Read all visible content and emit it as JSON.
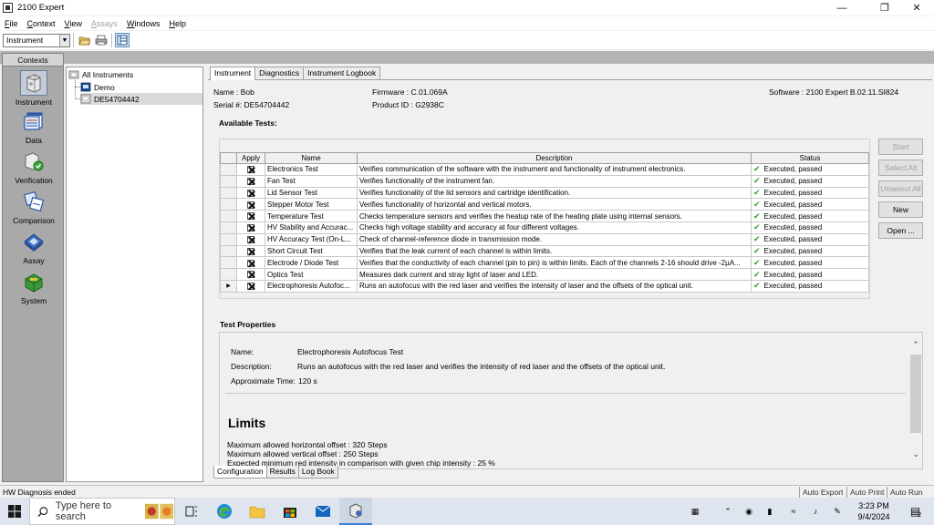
{
  "window": {
    "title": "2100 Expert"
  },
  "menu": [
    {
      "label": "File",
      "u": "F",
      "rest": "ile",
      "disabled": false
    },
    {
      "label": "Context",
      "u": "C",
      "rest": "ontext",
      "disabled": false
    },
    {
      "label": "View",
      "u": "V",
      "rest": "iew",
      "disabled": false
    },
    {
      "label": "Assays",
      "u": "A",
      "rest": "ssays",
      "disabled": true
    },
    {
      "label": "Windows",
      "u": "W",
      "rest": "indows",
      "disabled": false
    },
    {
      "label": "Help",
      "u": "H",
      "rest": "elp",
      "disabled": false
    }
  ],
  "toolbar": {
    "context_value": "Instrument"
  },
  "contexts": {
    "header": "Contexts",
    "items": [
      {
        "label": "Instrument",
        "icon": "instrument-icon"
      },
      {
        "label": "Data",
        "icon": "data-icon"
      },
      {
        "label": "Verification",
        "icon": "verification-icon"
      },
      {
        "label": "Comparison",
        "icon": "comparison-icon"
      },
      {
        "label": "Assay",
        "icon": "assay-icon"
      },
      {
        "label": "System",
        "icon": "system-icon"
      }
    ]
  },
  "tree": {
    "root": "All Instruments",
    "children": [
      "Demo",
      "DE54704442"
    ]
  },
  "tabs": [
    "Instrument",
    "Diagnostics",
    "Instrument Logbook"
  ],
  "instrument": {
    "name": "Name : Bob",
    "serial": "Serial #: DE54704442",
    "firmware": "Firmware : C.01.069A",
    "product": "Product ID : G2938C",
    "software": "Software : 2100 Expert B.02.11.SI824"
  },
  "available_tests": {
    "heading": "Available Tests:",
    "columns": [
      "Apply",
      "Name",
      "Description",
      "Status"
    ],
    "rows": [
      {
        "name": "Electronics Test",
        "desc": "Verifies communication of the software with the instrument and functionality of instrument electronics.",
        "status": "Executed, passed"
      },
      {
        "name": "Fan Test",
        "desc": "Verifies functionality of the instrument fan.",
        "status": "Executed, passed"
      },
      {
        "name": "Lid Sensor Test",
        "desc": "Verifies functionality of the lid sensors and cartridge identification.",
        "status": "Executed, passed"
      },
      {
        "name": "Stepper Motor Test",
        "desc": "Verifies functionality of horizontal and vertical motors.",
        "status": "Executed, passed"
      },
      {
        "name": "Temperature Test",
        "desc": "Checks temperature sensors and verifies the heatup rate of the heating plate using internal sensors.",
        "status": "Executed, passed"
      },
      {
        "name": "HV Stability and Accurac...",
        "desc": "Checks high voltage stability and accuracy at four different voltages.",
        "status": "Executed, passed"
      },
      {
        "name": "HV Accuracy Test (On-L...",
        "desc": "Check of channel-reference diode in transmission mode.",
        "status": "Executed, passed"
      },
      {
        "name": "Short Circuit Test",
        "desc": "Verifies that the leak current of each channel is within limits.",
        "status": "Executed, passed"
      },
      {
        "name": "Electrode / Diode Test",
        "desc": "Verifies that the conductivity of each  channel (pin to pin) is within limits. Each of the channels 2-16 should drive -2µA...",
        "status": "Executed, passed"
      },
      {
        "name": "Optics Test",
        "desc": "Measures dark current and stray light of laser and LED.",
        "status": "Executed, passed"
      },
      {
        "name": "Electrophoresis Autofoc...",
        "desc": "Runs an autofocus with the red laser and verifies the intensity of laser and the offsets of the optical unit.",
        "status": "Executed, passed"
      }
    ]
  },
  "buttons": {
    "start": "Start",
    "select_all": "Select All",
    "unselect_all": "Unselect All",
    "new": "New",
    "open": "Open ..."
  },
  "test_properties": {
    "heading": "Test Properties",
    "name_label": "Name:",
    "name_value": "Electrophoresis Autofocus Test",
    "desc_label": "Description:",
    "desc_value": "Runs an autofocus with the red laser and verifies the intensity of red laser and the offsets of the optical unit.",
    "time_label": "Approximate Time:",
    "time_value": "120 s",
    "limits_title": "Limits",
    "limits": [
      "Maximum allowed horizontal offset :  320  Steps",
      "Maximum allowed vertical offset :  250  Steps",
      "Expected minimum red intensity in comparison with given chip intensity :  25  %"
    ]
  },
  "bottom_tabs": [
    "Configuration",
    "Results",
    "Log Book"
  ],
  "status": {
    "message": "HW Diagnosis ended",
    "panes": [
      "Auto Export",
      "Auto Print",
      "Auto Run"
    ]
  },
  "taskbar": {
    "search_placeholder": "Type here to search",
    "time": "3:23 PM",
    "date": "9/4/2024"
  }
}
